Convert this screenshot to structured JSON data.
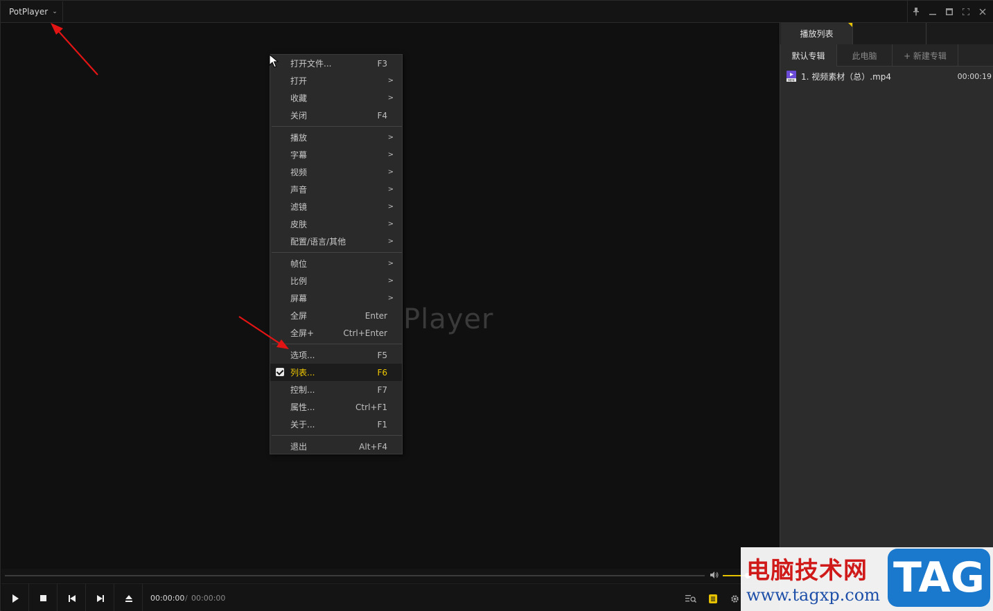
{
  "titlebar": {
    "app_name": "PotPlayer",
    "chevron": "⌵",
    "controls": [
      "pin-icon",
      "minimize-icon",
      "restore-icon",
      "fullscreen-icon",
      "close-icon"
    ]
  },
  "video": {
    "logo_text": "Player"
  },
  "playlist": {
    "title": "播放列表",
    "subtabs": [
      "默认专辑",
      "此电脑",
      "+ 新建专辑"
    ],
    "items": [
      {
        "name": "1. 视频素材（总）.mp4",
        "duration": "00:00:19"
      }
    ]
  },
  "menu": {
    "groups": [
      [
        {
          "label": "打开文件...",
          "shortcut": "F3"
        },
        {
          "label": "打开",
          "submenu": ">"
        },
        {
          "label": "收藏",
          "submenu": ">"
        },
        {
          "label": "关闭",
          "shortcut": "F4"
        }
      ],
      [
        {
          "label": "播放",
          "submenu": ">"
        },
        {
          "label": "字幕",
          "submenu": ">"
        },
        {
          "label": "视频",
          "submenu": ">"
        },
        {
          "label": "声音",
          "submenu": ">"
        },
        {
          "label": "滤镜",
          "submenu": ">"
        },
        {
          "label": "皮肤",
          "submenu": ">"
        },
        {
          "label": "配置/语言/其他",
          "submenu": ">"
        }
      ],
      [
        {
          "label": "帧位",
          "submenu": ">"
        },
        {
          "label": "比例",
          "submenu": ">"
        },
        {
          "label": "屏幕",
          "submenu": ">"
        },
        {
          "label": "全屏",
          "shortcut": "Enter"
        },
        {
          "label": "全屏+",
          "shortcut": "Ctrl+Enter"
        }
      ],
      [
        {
          "label": "选项...",
          "shortcut": "F5"
        },
        {
          "label": "列表...",
          "shortcut": "F6",
          "checked": true,
          "highlighted": true
        },
        {
          "label": "控制...",
          "shortcut": "F7"
        },
        {
          "label": "属性...",
          "shortcut": "Ctrl+F1"
        },
        {
          "label": "关于...",
          "shortcut": "F1"
        }
      ],
      [
        {
          "label": "退出",
          "shortcut": "Alt+F4"
        }
      ]
    ]
  },
  "controls": {
    "time_current": "00:00:00",
    "time_separator": "/",
    "time_total": "00:00:00",
    "volume_level": 1.0
  },
  "watermark": {
    "site_name": "电脑技术网",
    "url": "www.tagxp.com",
    "tag": "TAG"
  },
  "colors": {
    "accent": "#e6c200",
    "highlight_text": "#f0c800",
    "annotation": "#e31414",
    "watermark_red": "#d01a1a",
    "watermark_blue": "#1a79cc"
  }
}
